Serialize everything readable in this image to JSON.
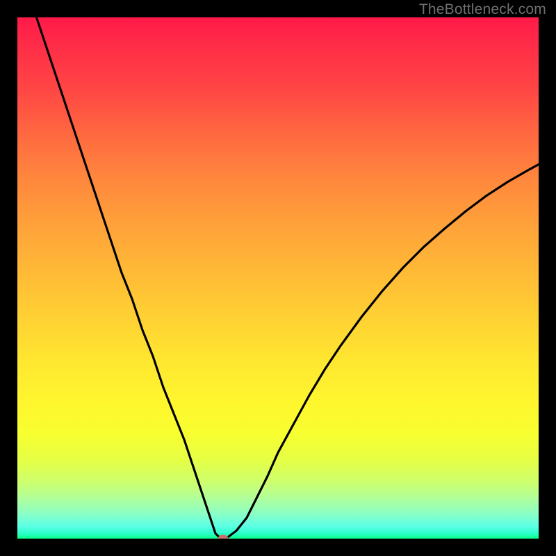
{
  "watermark": "TheBottleneck.com",
  "chart_data": {
    "type": "line",
    "title": "",
    "xlabel": "",
    "ylabel": "",
    "xlim": [
      0,
      100
    ],
    "ylim": [
      0,
      100
    ],
    "x": [
      0,
      2,
      4,
      6,
      8,
      10,
      12,
      14,
      16,
      18,
      20,
      22,
      24,
      26,
      28,
      30,
      32,
      34,
      36,
      37,
      38,
      39,
      40,
      42,
      44,
      46,
      48,
      50,
      53,
      56,
      59,
      62,
      66,
      70,
      74,
      78,
      82,
      86,
      90,
      94,
      98,
      100
    ],
    "values": [
      112,
      105,
      99,
      93,
      87,
      81,
      75,
      69,
      63,
      57,
      51,
      46,
      40,
      35,
      29,
      24,
      19,
      13,
      7,
      4,
      1,
      0,
      0,
      1.5,
      4,
      8,
      12,
      16.5,
      22,
      27.5,
      32.5,
      37,
      42.5,
      47.5,
      52,
      56,
      59.5,
      62.8,
      65.8,
      68.4,
      70.7,
      71.8
    ],
    "minimum_marker": {
      "x": 39.5,
      "y": 0
    },
    "background_gradient": {
      "top_color": "#ff1a49",
      "mid_color": "#fff62e",
      "bottom_color": "#0aff86"
    }
  }
}
